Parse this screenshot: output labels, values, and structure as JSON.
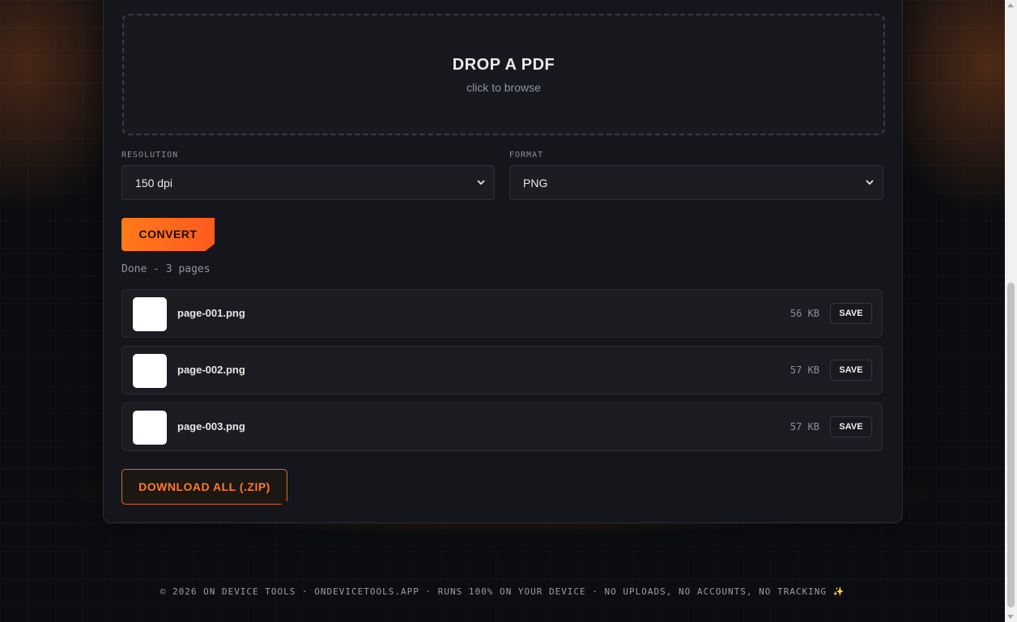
{
  "dropzone": {
    "title": "DROP A PDF",
    "subtitle": "click to browse"
  },
  "options": {
    "resolution": {
      "label": "RESOLUTION",
      "value": "150 dpi"
    },
    "format": {
      "label": "FORMAT",
      "value": "PNG"
    }
  },
  "convert_label": "CONVERT",
  "status": "Done - 3 pages",
  "files": [
    {
      "name": "page-001.png",
      "size": "56 KB",
      "action": "SAVE"
    },
    {
      "name": "page-002.png",
      "size": "57 KB",
      "action": "SAVE"
    },
    {
      "name": "page-003.png",
      "size": "57 KB",
      "action": "SAVE"
    }
  ],
  "download_all_label": "DOWNLOAD ALL (.ZIP)",
  "footer": "© 2026 ON DEVICE TOOLS · ONDEVICETOOLS.APP · RUNS 100% ON YOUR DEVICE · NO UPLOADS, NO ACCOUNTS, NO TRACKING ✨",
  "colors": {
    "accent": "#ff6a1f",
    "background": "#0c0d11",
    "card": "#15161b"
  }
}
